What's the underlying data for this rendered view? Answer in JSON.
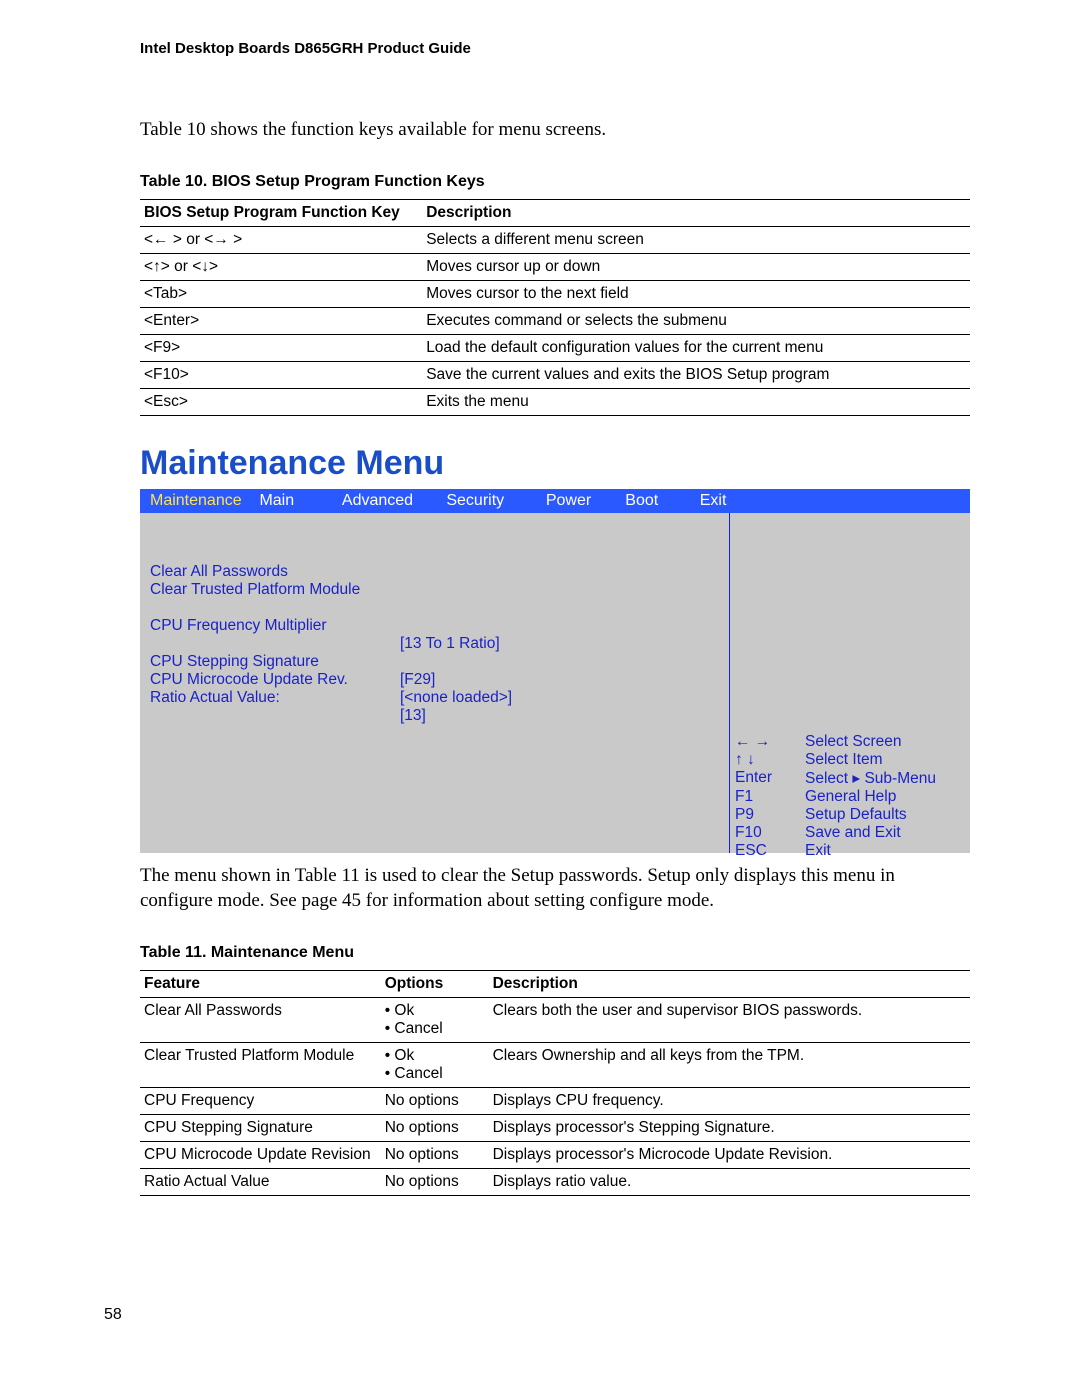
{
  "doc_header": "Intel Desktop Boards D865GRH Product Guide",
  "intro_text": "Table 10 shows the function keys available for menu screens.",
  "table10": {
    "caption": "Table 10.   BIOS Setup Program Function Keys",
    "col1_header": "BIOS Setup Program Function Key",
    "col2_header": "Description",
    "rows": [
      {
        "key": "<← > or <→ >",
        "desc": "Selects a different menu screen"
      },
      {
        "key": "<↑> or <↓>",
        "desc": "Moves cursor up or down"
      },
      {
        "key": "<Tab>",
        "desc": "Moves cursor to the next field"
      },
      {
        "key": "<Enter>",
        "desc": "Executes command or selects the submenu"
      },
      {
        "key": "<F9>",
        "desc": "Load the default configuration values for the current menu"
      },
      {
        "key": "<F10>",
        "desc": "Save the current values and exits the BIOS Setup program"
      },
      {
        "key": "<Esc>",
        "desc": "Exits the menu"
      }
    ]
  },
  "section_title": "Maintenance Menu",
  "bios": {
    "tabs": [
      "Maintenance",
      "Main",
      "Advanced",
      "Security",
      "Power",
      "Boot",
      "Exit"
    ],
    "items": {
      "clear_pw": "Clear All Passwords",
      "clear_tpm": "Clear Trusted Platform Module",
      "cpu_mult": "CPU Frequency Multiplier",
      "cpu_mult_val": "[13 To 1 Ratio]",
      "cpu_step": "CPU Stepping Signature",
      "cpu_step_val": "[F29]",
      "cpu_micro": "CPU Microcode Update Rev.",
      "cpu_micro_val": "[<none loaded>]",
      "ratio": "Ratio Actual Value:",
      "ratio_val": "[13]"
    },
    "help": [
      {
        "k": "←   →",
        "d": "Select Screen"
      },
      {
        "k": "↑  ↓",
        "d": "Select Item"
      },
      {
        "k": "Enter",
        "d": "Select  ▸ Sub-Menu"
      },
      {
        "k": "F1",
        "d": "General Help"
      },
      {
        "k": "P9",
        "d": "Setup Defaults"
      },
      {
        "k": "F10",
        "d": "Save and Exit"
      },
      {
        "k": "ESC",
        "d": "Exit"
      }
    ]
  },
  "body_text": "The menu shown in Table 11 is used to clear the Setup passwords.  Setup only displays this menu in configure mode.  See page 45 for information about setting configure mode.",
  "table11": {
    "caption": "Table 11.   Maintenance Menu",
    "h1": "Feature",
    "h2": "Options",
    "h3": "Description",
    "rows": [
      {
        "f": "Clear All Passwords",
        "o1": "•  Ok",
        "o2": "•  Cancel",
        "d": "Clears both the user and supervisor BIOS passwords."
      },
      {
        "f": "Clear Trusted Platform Module",
        "o1": "•  Ok",
        "o2": "•  Cancel",
        "d": "Clears Ownership and all keys from the TPM."
      },
      {
        "f": "CPU Frequency",
        "o1": "No options",
        "o2": "",
        "d": "Displays CPU frequency."
      },
      {
        "f": "CPU Stepping Signature",
        "o1": "No options",
        "o2": "",
        "d": "Displays processor's Stepping Signature."
      },
      {
        "f": "CPU Microcode Update Revision",
        "o1": "No options",
        "o2": "",
        "d": "Displays processor's Microcode Update Revision."
      },
      {
        "f": "Ratio Actual Value",
        "o1": "No options",
        "o2": "",
        "d": "Displays ratio value."
      }
    ]
  },
  "page_number": "58"
}
